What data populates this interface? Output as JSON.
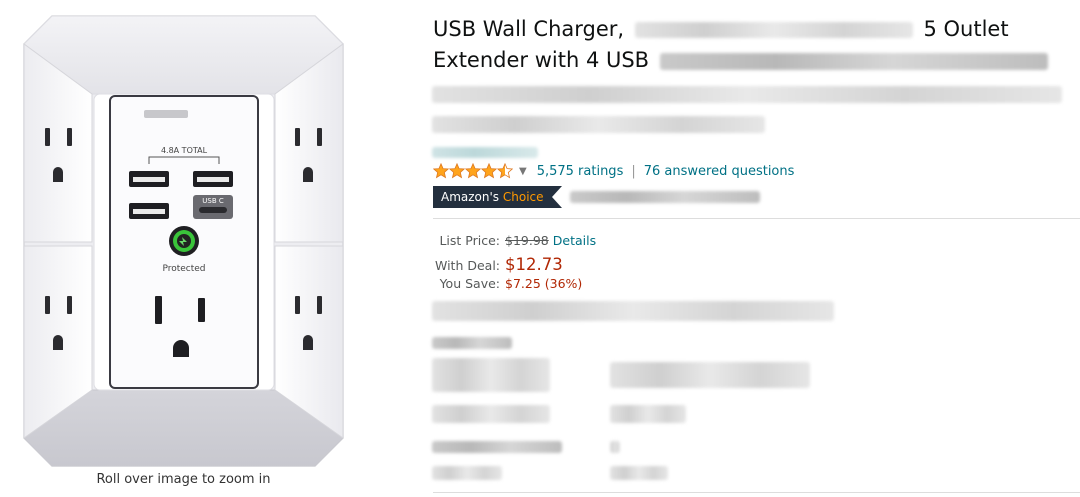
{
  "product": {
    "title_part1": "USB Wall Charger,",
    "title_part2": "5 Outlet",
    "title_line2": "Extender with 4 USB",
    "image_alt": "USB wall charger outlet extender",
    "zoom_hint": "Roll over image to zoom in",
    "device": {
      "label_total": "4.8A TOTAL",
      "usb_c_label": "USB C",
      "protected_label": "Protected"
    }
  },
  "rating": {
    "stars_value": 4.5,
    "stars_max": 5,
    "ratings_text": "5,575 ratings",
    "separator": "|",
    "questions_text": "76 answered questions"
  },
  "badge": {
    "prefix": "Amazon's",
    "word": "Choice"
  },
  "pricing": {
    "list_label": "List Price:",
    "list_price": "$19.98",
    "details_label": "Details",
    "deal_label": "With Deal:",
    "deal_price": "$12.73",
    "save_label": "You Save:",
    "save_amount": "$7.25 (36%)"
  },
  "colors": {
    "link": "#007185",
    "price_red": "#b12704",
    "star_orange": "#ffa41c",
    "badge_navy": "#232f3e",
    "badge_orange": "#ff9900"
  },
  "icons": {
    "caret": "chevron-down-icon",
    "star": "star-icon"
  }
}
